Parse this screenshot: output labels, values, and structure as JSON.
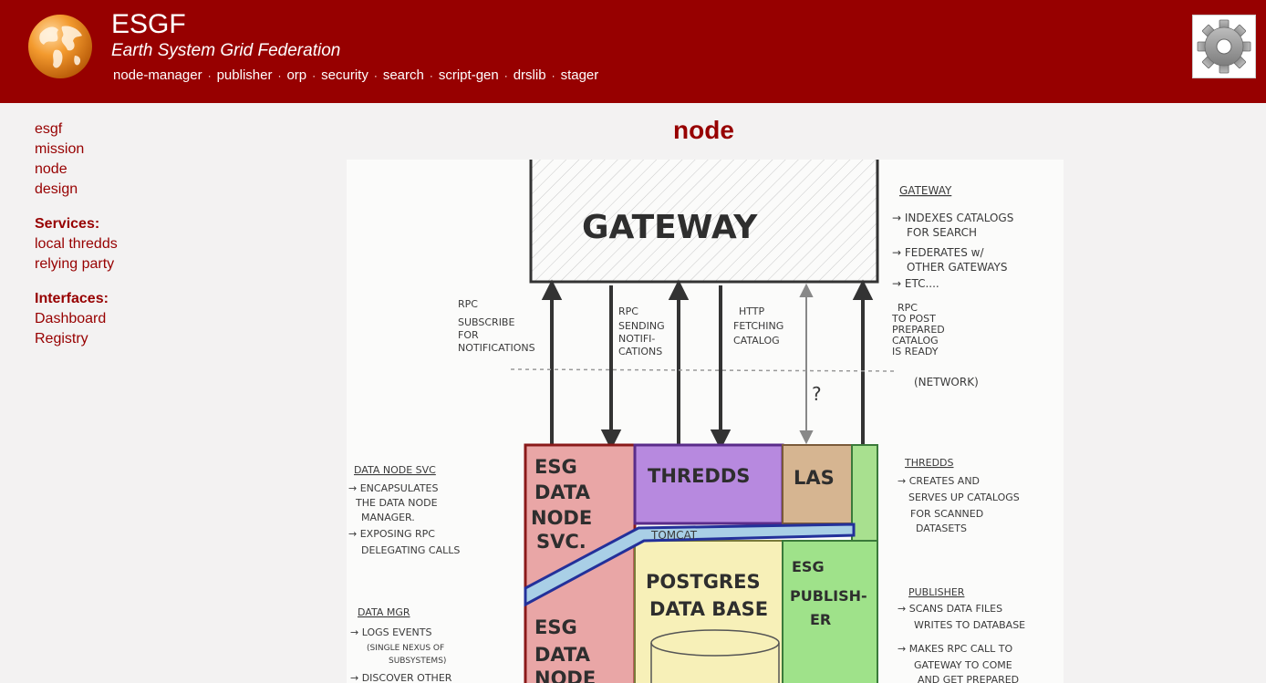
{
  "header": {
    "title": "ESGF",
    "subtitle": "Earth System Grid Federation",
    "nav": [
      "node-manager",
      "publisher",
      "orp",
      "security",
      "search",
      "script-gen",
      "drslib",
      "stager"
    ],
    "separator": "·"
  },
  "sidebar": {
    "main_links": [
      "esgf",
      "mission",
      "node",
      "design"
    ],
    "services_heading": "Services:",
    "services": [
      "local thredds",
      "relying party"
    ],
    "interfaces_heading": "Interfaces:",
    "interfaces": [
      "Dashboard",
      "Registry"
    ]
  },
  "main": {
    "title": "node"
  },
  "diagram": {
    "gateway_label": "GATEWAY",
    "gateway_heading": "GATEWAY",
    "gateway_notes": [
      "→ INDEXES CATALOGS",
      "FOR SEARCH",
      "→ FEDERATES w/",
      "OTHER GATEWAYS",
      "→ ETC...."
    ],
    "arrow_labels": {
      "rpc_subscribe": [
        "RPC",
        "SUBSCRIBE",
        "FOR",
        "NOTIFICATIONS"
      ],
      "rpc_sending": [
        "RPC",
        "SENDING",
        "NOTIFI-",
        "CATIONS"
      ],
      "http_fetching": [
        "HTTP",
        "FETCHING",
        "CATALOG"
      ],
      "rpc_post": [
        "RPC",
        "TO POST",
        "PREPARED",
        "CATALOG",
        "IS READY"
      ],
      "network": "(NETWORK)",
      "question": "?"
    },
    "boxes": {
      "esg_data_node_svc": [
        "ESG",
        "DATA",
        "NODE",
        "SVC."
      ],
      "thredds": "THREDDS",
      "las": "LAS",
      "tomcat": "TOMCAT",
      "postgres": [
        "POSTGRES",
        "DATA BASE"
      ],
      "esg_publisher": [
        "ESG",
        "PUBLISH-",
        "ER"
      ],
      "esg_data_node": [
        "ESG",
        "DATA",
        "NODE"
      ]
    },
    "left_notes": {
      "data_node_svc_heading": "DATA NODE SVC",
      "data_node_svc": [
        "→ ENCAPSULATES",
        "THE DATA NODE",
        "MANAGER.",
        "→ EXPOSING RPC",
        "DELEGATING CALLS"
      ],
      "data_mgr_heading": "DATA MGR",
      "data_mgr": [
        "→ LOGS EVENTS",
        "(SINGLE NEXUS OF",
        "SUBSYSTEMS)",
        "→ DISCOVER OTHER"
      ]
    },
    "right_notes": {
      "thredds_heading": "THREDDS",
      "thredds": [
        "→ CREATES AND",
        "SERVES UP CATALOGS",
        "FOR SCANNED",
        "DATASETS"
      ],
      "publisher_heading": "PUBLISHER",
      "publisher": [
        "→ SCANS DATA FILES",
        "WRITES TO DATABASE",
        "→ MAKES RPC CALL TO",
        "GATEWAY TO COME",
        "AND GET PREPARED"
      ]
    }
  },
  "colors": {
    "brand": "#970000",
    "background": "#f3f2f2"
  },
  "icons": {
    "logo": "globe-icon",
    "settings": "gear-icon"
  }
}
